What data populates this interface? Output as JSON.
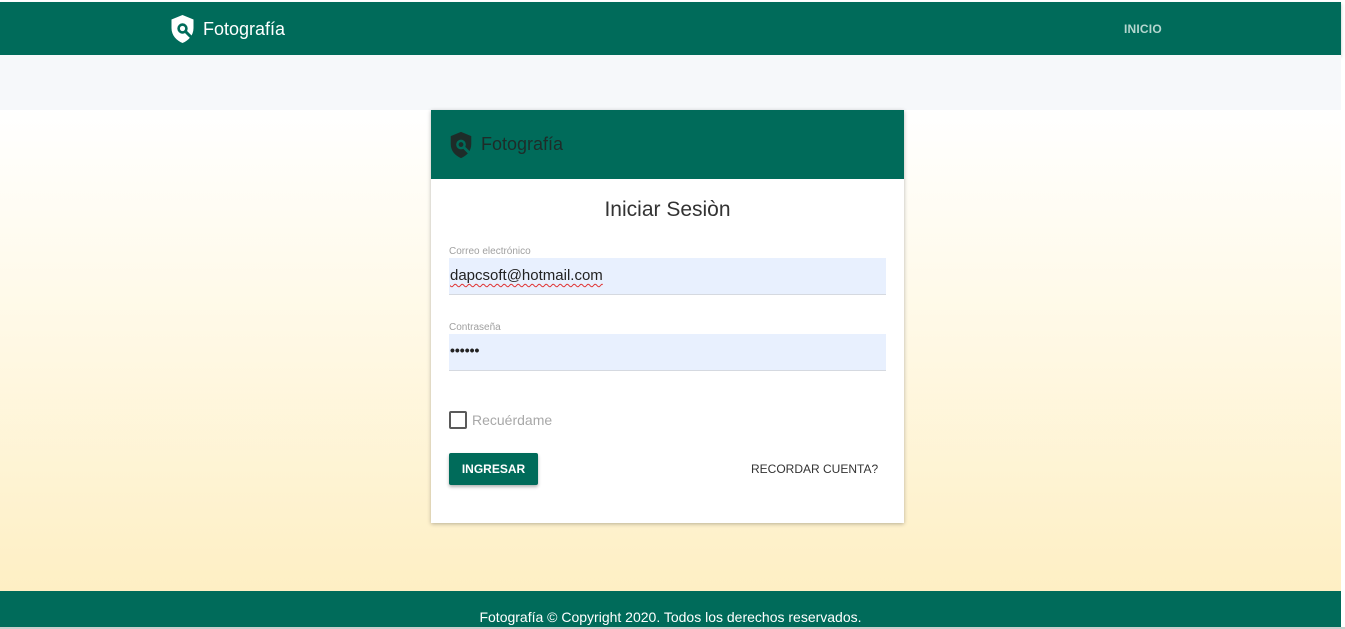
{
  "header": {
    "brand": "Fotografía",
    "nav_inicio": "INICIO"
  },
  "login_card": {
    "brand": "Fotografía",
    "title": "Iniciar Sesiòn",
    "email_label": "Correo electrónico",
    "email_value": "dapcsoft@hotmail.com",
    "password_label": "Contraseña",
    "password_mask": "••••••",
    "remember_label": "Recuérdame",
    "remember_checked": false,
    "submit_label": "INGRESAR",
    "forgot_label": "RECORDAR CUENTA?"
  },
  "footer": {
    "text": "Fotografía © Copyright 2020. Todos los derechos reservados."
  },
  "icons": {
    "brand_logo": "shield-search-icon"
  },
  "colors": {
    "primary": "#006b5a",
    "field_bg": "#e8f0fe",
    "gradient_end": "#feefc4"
  }
}
